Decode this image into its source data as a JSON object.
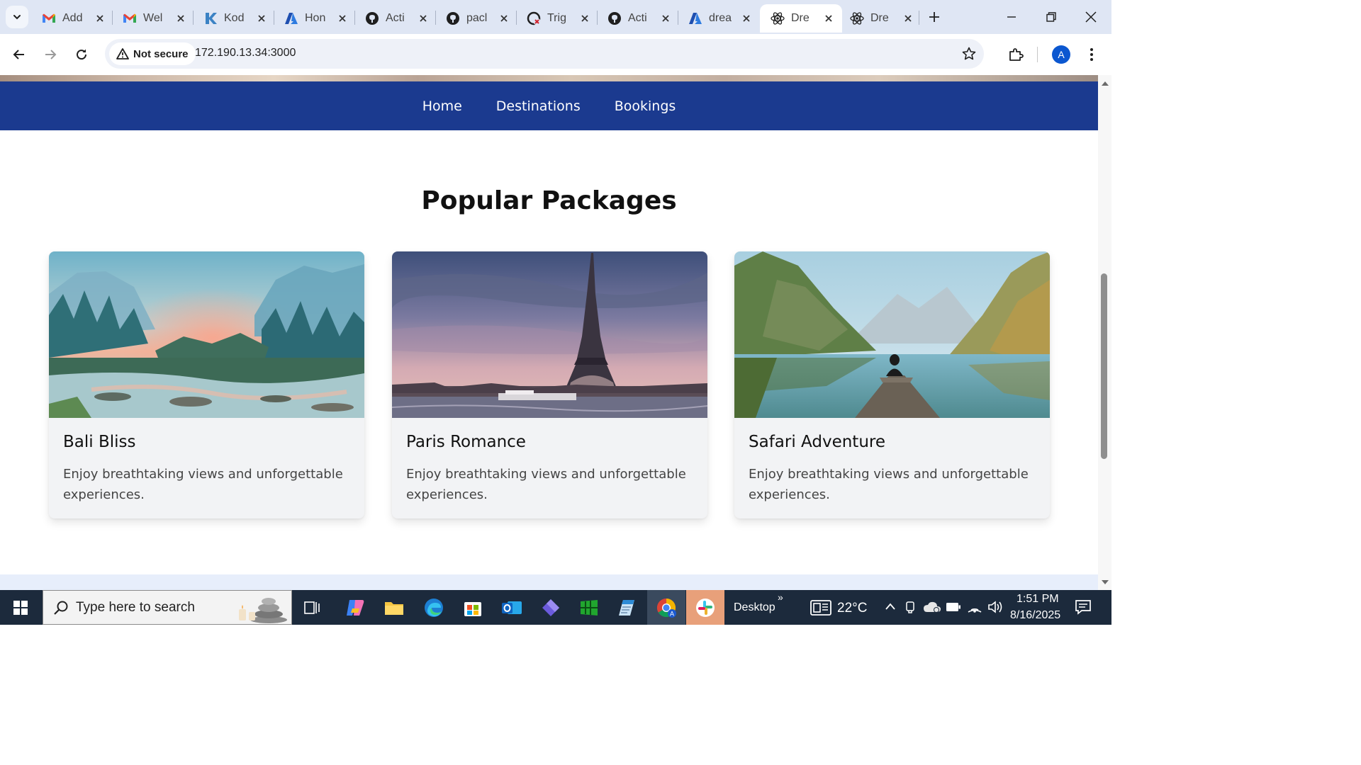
{
  "browser": {
    "tabs": [
      {
        "title": "Add",
        "icon": "gmail-icon"
      },
      {
        "title": "Wel",
        "icon": "gmail-icon"
      },
      {
        "title": "Kod",
        "icon": "kodekloud-icon"
      },
      {
        "title": "Hon",
        "icon": "azure-icon"
      },
      {
        "title": "Acti",
        "icon": "github-icon"
      },
      {
        "title": "pacl",
        "icon": "github-icon"
      },
      {
        "title": "Trig",
        "icon": "github-failed-icon"
      },
      {
        "title": "Acti",
        "icon": "github-icon"
      },
      {
        "title": "drea",
        "icon": "azure-icon"
      },
      {
        "title": "Dre",
        "icon": "react-icon",
        "active": true
      },
      {
        "title": "Dre",
        "icon": "react-icon"
      }
    ],
    "security_label": "Not secure",
    "url": "172.190.13.34:3000",
    "profile_initial": "A"
  },
  "site": {
    "nav": [
      "Home",
      "Destinations",
      "Bookings"
    ],
    "section_title": "Popular Packages",
    "packages": [
      {
        "name": "Bali Bliss",
        "description": "Enjoy breathtaking views and unforgettable experiences.",
        "image": "misty-mountain-forest-river"
      },
      {
        "name": "Paris Romance",
        "description": "Enjoy breathtaking views and unforgettable experiences.",
        "image": "eiffel-tower-sunset"
      },
      {
        "name": "Safari Adventure",
        "description": "Enjoy breathtaking views and unforgettable experiences.",
        "image": "alpine-lake-pier"
      }
    ]
  },
  "taskbar": {
    "search_placeholder": "Type here to search",
    "desktop_label": "Desktop",
    "weather": "22°C",
    "time": "1:51 PM",
    "date": "8/16/2025"
  },
  "colors": {
    "site_nav": "#1b3a8f",
    "card_bg": "#f2f3f5",
    "tabstrip": "#dfe6f4",
    "taskbar": "#1c2a3c"
  }
}
